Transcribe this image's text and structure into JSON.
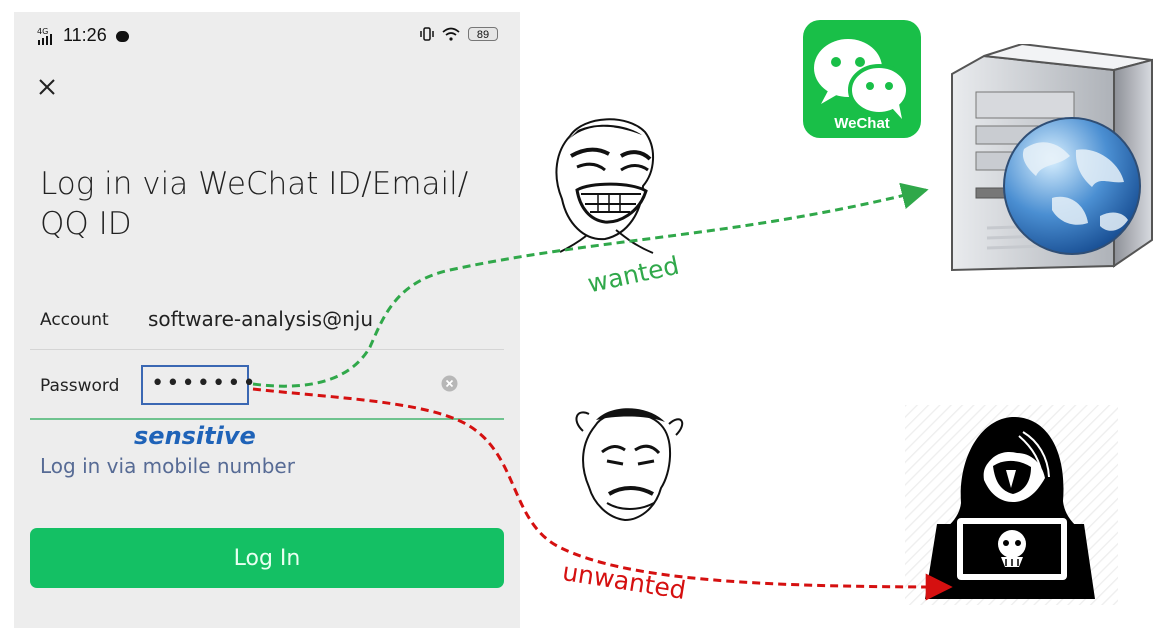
{
  "status_bar": {
    "network": "4G",
    "time": "11:26",
    "battery": "89"
  },
  "login": {
    "title": "Log in via WeChat ID/Email/ QQ ID",
    "account_label": "Account",
    "account_value": "software-analysis@nju",
    "password_label": "Password",
    "password_value": "•••••••",
    "alternate_login": "Log in via mobile number",
    "login_button": "Log In"
  },
  "annotations": {
    "sensitive": "sensitive",
    "wanted": "wanted",
    "unwanted": "unwanted",
    "app_name": "WeChat"
  },
  "colors": {
    "phone_background": "#ededed",
    "login_button": "#14c064",
    "sensitive": "#1f63b8",
    "wanted_flow": "#30a84a",
    "unwanted_flow": "#d51010",
    "wechat_brand": "#19bf48"
  },
  "icons": {
    "close": "close-icon",
    "clear": "clear-icon",
    "network": "signal-icon",
    "message": "message-icon",
    "vibration": "vibration-icon",
    "wifi": "wifi-icon",
    "battery": "battery-icon",
    "wechat": "wechat-logo-icon",
    "server": "server-globe-icon",
    "hacker": "hacker-icon"
  }
}
